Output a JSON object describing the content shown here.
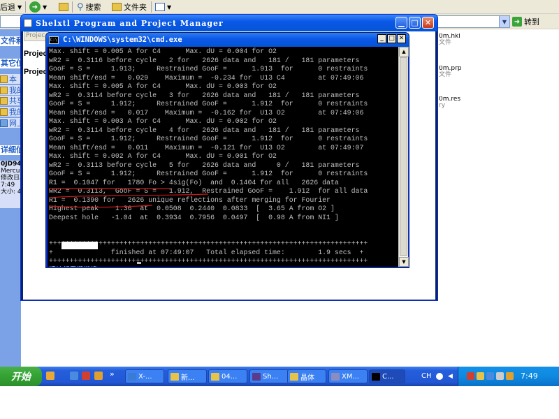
{
  "toolbar": {
    "back_label": "后退",
    "search_label": "搜索",
    "folders_label": "文件夹"
  },
  "address": {
    "go_label": "转到"
  },
  "explorer_left": {
    "tasks_header": "文件和",
    "places_header": "其它位",
    "places_items": [
      "本",
      "我的",
      "共享",
      "我的",
      "网上"
    ],
    "details_header": "详细信",
    "details_lines": [
      "0JD94_",
      "Mercury",
      "修改日期",
      "7:49",
      "大小: 4"
    ]
  },
  "explorer_files": [
    {
      "name": "0m.hkl",
      "type": "文件"
    },
    {
      "name": "0m.prp",
      "type": "文件"
    },
    {
      "name": "0m.res",
      "type": "ry"
    }
  ],
  "shelxtl": {
    "title": "Shelxtl Program and Project Manager",
    "tab_label": "Projec",
    "project_label_1": "Projec",
    "project_label_2": "Projec"
  },
  "cmd": {
    "title": "C:\\WINDOWS\\system32\\cmd.exe",
    "lines": [
      "Max. shift = 0.005 A for C4      Max. dU = 0.004 for O2",
      "wR2 =  0.3116 before cycle   2 for   2626 data and   181 /   181 parameters",
      "GooF = S =     1.913;     Restrained GooF =      1.913  for      0 restraints",
      "Mean shift/esd =   0.029    Maximum =  -0.234 for  U13 C4        at 07:49:06",
      "Max. shift = 0.005 A for C4      Max. dU = 0.003 for O2",
      "wR2 =  0.3114 before cycle   3 for   2626 data and   181 /   181 parameters",
      "GooF = S =     1.912;     Restrained GooF =      1.912  for      0 restraints",
      "Mean shift/esd =   0.017    Maximum =  -0.162 for  U13 O2        at 07:49:06",
      "Max. shift = 0.003 A for C4      Max. dU = 0.002 for O2",
      "wR2 =  0.3114 before cycle   4 for   2626 data and   181 /   181 parameters",
      "GooF = S =     1.912;     Restrained GooF =      1.912  for      0 restraints",
      "Mean shift/esd =   0.011    Maximum =  -0.121 for  U13 O2        at 07:49:07",
      "Max. shift = 0.002 A for C4      Max. dU = 0.001 for O2",
      "wR2 =  0.3113 before cycle   5 for   2626 data and     0 /   181 parameters",
      "GooF = S =     1.912;     Restrained GooF =      1.912  for      0 restraints",
      "R1 =  0.1047 for   1780 Fo > 4sig(Fo)  and  0.1404 for all   2626 data",
      "wR2 =  0.3113,  GooF = S =   1.912,  Restrained GooF =    1.912  for all data",
      "R1 =  0.1390 for   2626 unique reflections after merging for Fourier",
      "Highest peak    1.36  at  0.0508  0.2440  0.0833  [  3.65 A from O2 ]",
      "Deepest hole   -1.04  at  0.3934  0.7956  0.0497  [  0.98 A from NI1 ]",
      "",
      "",
      "+++++++++++++++++++++++++++++++++++++++++++++++++++++++++++++++++++++++++++++",
      "+              finished at 07:49:07   Total elapsed time:        1.9 secs  +",
      "+++++++++++++++++++++++++++++++++++++++++++++++++++++++++++++++++++++++++++++",
      "请按任意键继续. . ."
    ]
  },
  "taskbar": {
    "start_label": "开始",
    "chevron": "»",
    "tasks": [
      {
        "label": "X-...",
        "icon_color": "#3a7bd5"
      },
      {
        "label": "新...",
        "icon_color": "#e8c34a"
      },
      {
        "label": "04...",
        "icon_color": "#e8c34a"
      },
      {
        "label": "Sh...",
        "icon_color": "#5a3b8c"
      },
      {
        "label": "晶体",
        "icon_color": "#e8c34a"
      },
      {
        "label": "XM...",
        "icon_color": "#8c8cbf"
      },
      {
        "label": "C...",
        "icon_color": "#000000"
      }
    ],
    "lang_label": "CH",
    "clock": "7:49"
  }
}
